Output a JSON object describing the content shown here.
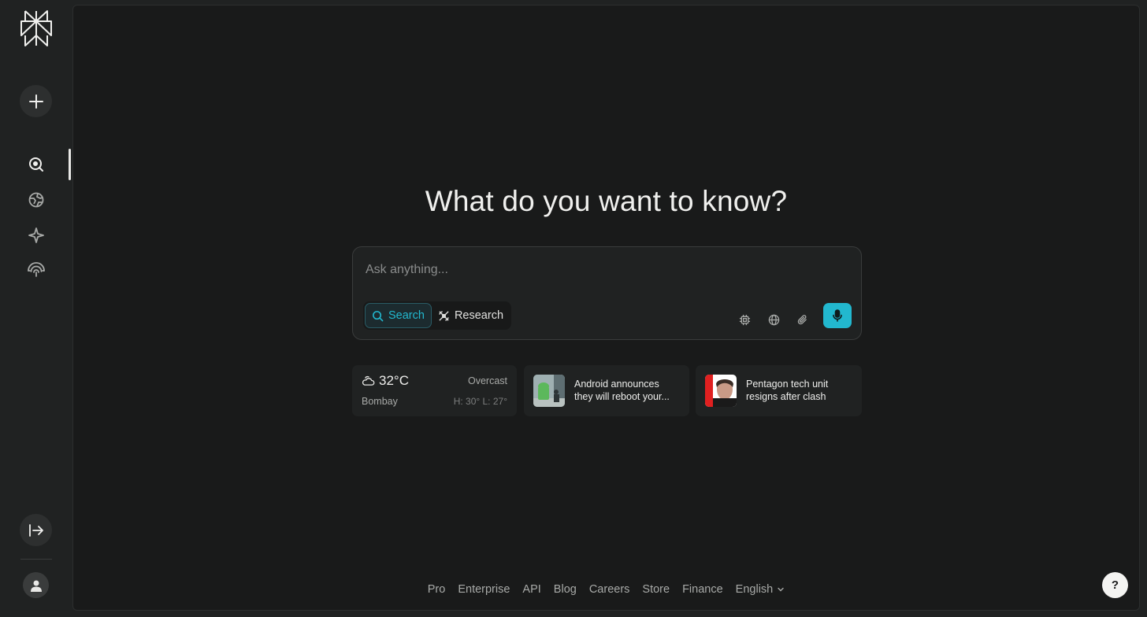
{
  "headline": "What do you want to know?",
  "search": {
    "placeholder": "Ask anything...",
    "modes": [
      {
        "label": "Search",
        "active": true
      },
      {
        "label": "Research",
        "active": false
      }
    ]
  },
  "weather": {
    "temperature": "32°C",
    "condition": "Overcast",
    "city": "Bombay",
    "high_low": "H: 30° L: 27°"
  },
  "news": [
    {
      "title": "Android announces they will reboot your..."
    },
    {
      "title": "Pentagon tech unit resigns after clash wit..."
    }
  ],
  "footer": {
    "links": [
      "Pro",
      "Enterprise",
      "API",
      "Blog",
      "Careers",
      "Store",
      "Finance"
    ],
    "language": "English"
  },
  "help": "?",
  "colors": {
    "accent": "#22b8cf",
    "background": "#191a1a",
    "sidebar": "#202222"
  }
}
